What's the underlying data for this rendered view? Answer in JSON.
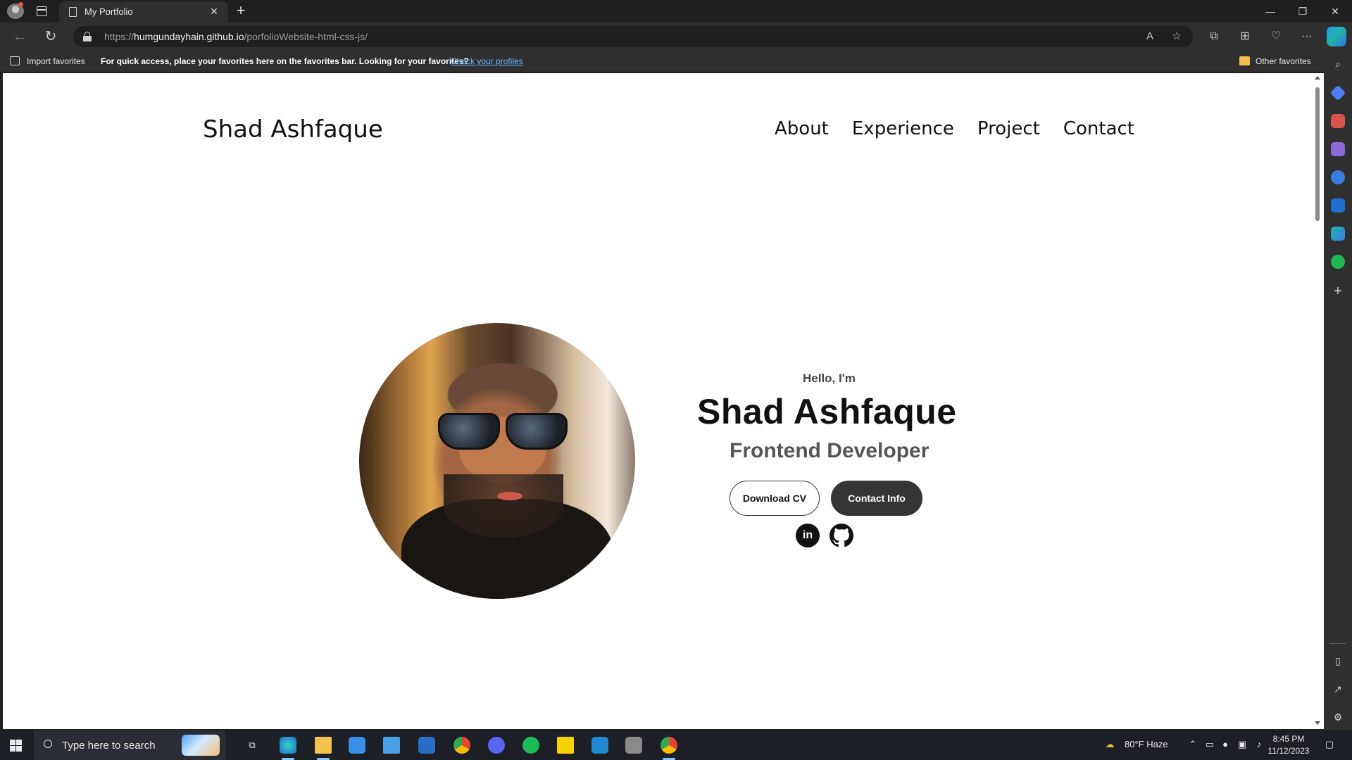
{
  "browser": {
    "tab_title": "My Portfolio",
    "tab_close": "✕",
    "new_tab": "+",
    "url_scheme": "https://",
    "url_host": "humgundayhain.github.io",
    "url_path": "/porfolioWebsite-html-css-js/",
    "window_controls": {
      "minimize": "—",
      "restore": "❐",
      "close": "✕"
    },
    "nav": {
      "back": "←",
      "reload": "↻",
      "more": "···",
      "read_aloud": "A",
      "favorite": "☆",
      "split": "⧉",
      "collections": "⊞",
      "health": "♡"
    }
  },
  "favorites_bar": {
    "import_label": "Import favorites",
    "message": "For quick access, place your favorites here on the favorites bar. Looking for your favorites?",
    "link_label": "Check your profiles",
    "other_label": "Other favorites"
  },
  "page": {
    "logo": "Shad Ashfaque",
    "nav": [
      "About",
      "Experience",
      "Project",
      "Contact"
    ],
    "hero": {
      "greeting": "Hello, I'm",
      "name": "Shad Ashfaque",
      "role": "Frontend Developer",
      "download_cv": "Download CV",
      "contact_info": "Contact Info",
      "linkedin": "in"
    }
  },
  "taskbar": {
    "search_placeholder": "Type here to search",
    "weather": "80°F  Haze",
    "time": "8:45 PM",
    "date": "11/12/2023"
  },
  "colors": {
    "accent": "#353535",
    "link": "#6fb3ff"
  }
}
